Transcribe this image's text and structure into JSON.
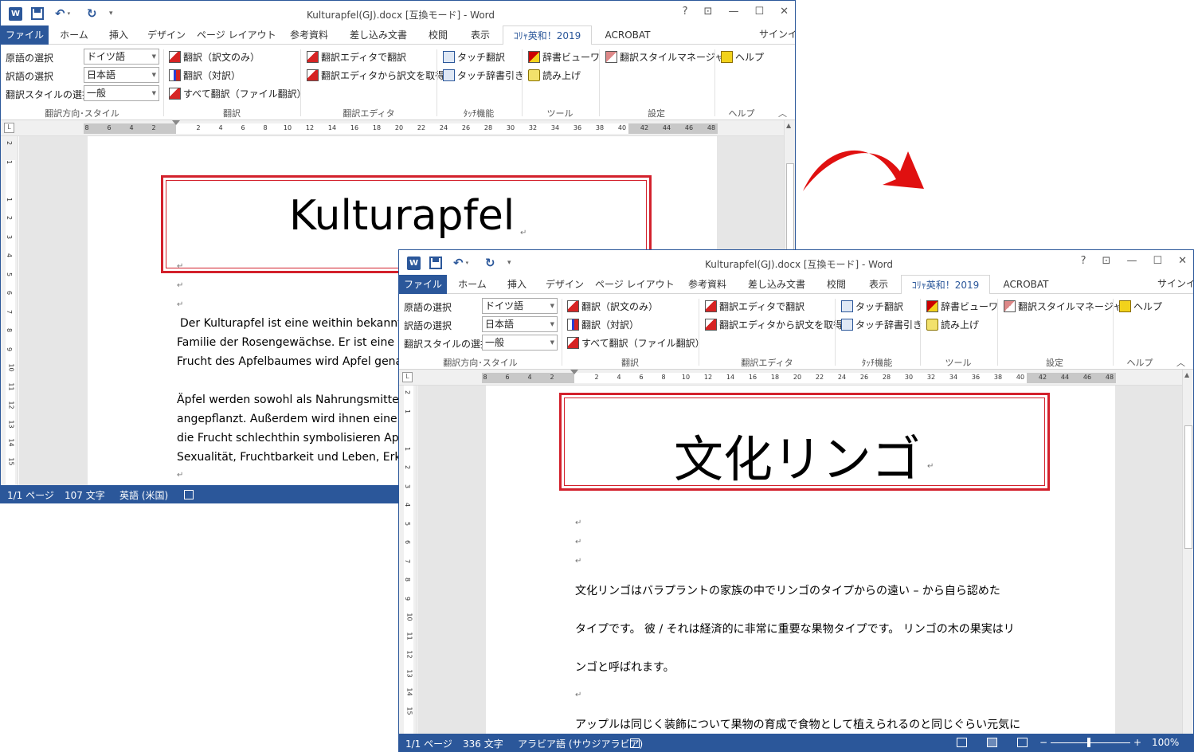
{
  "back_window": {
    "title": "Kulturapfel(GJ).docx [互換モード] - Word",
    "tabs": [
      "ファイル",
      "ホーム",
      "挿入",
      "デザイン",
      "ページ レイアウト",
      "参考資料",
      "差し込み文書",
      "校閲",
      "表示",
      "ｺﾘｬ英和！2019",
      "ACROBAT"
    ],
    "signin": "サインイン",
    "ribbon": {
      "src_lang_label": "原語の選択",
      "dst_lang_label": "訳語の選択",
      "style_label": "翻訳スタイルの選択",
      "src_lang_value": "ドイツ語",
      "dst_lang_value": "日本語",
      "style_value": "一般",
      "group_direction": "翻訳方向･スタイル",
      "btn_translate_only": "翻訳（訳文のみ）",
      "btn_translate_pair": "翻訳（対訳）",
      "btn_translate_all": "すべて翻訳（ファイル翻訳）",
      "group_translate": "翻訳",
      "btn_editor": "翻訳エディタで翻訳",
      "btn_editor_get": "翻訳エディタから訳文を取得",
      "group_editor": "翻訳エディタ",
      "btn_touch": "タッチ翻訳",
      "btn_touch_dict": "タッチ辞書引き",
      "group_touch": "ﾀｯﾁ機能",
      "btn_dict_viewer": "辞書ビューワ",
      "btn_read": "読み上げ",
      "group_tools": "ツール",
      "btn_style_mgr": "翻訳スタイルマネージャ",
      "group_settings": "設定",
      "btn_help": "ヘルプ",
      "group_help": "ヘルプ"
    },
    "doc": {
      "title": "Kulturapfel",
      "lines": [
        "Der Kulturapfel ist eine weithin bekannte",
        "Familie der Rosengewächse. Er ist eine wi",
        "Frucht des Apfelbaumes wird Apfel genan",
        "Äpfel werden sowohl als Nahrungsmittel",
        "angepflanzt. Außerdem wird ihnen eine W",
        "die Frucht schlechthin symbolisieren Apfe",
        "Sexualität, Fruchtbarkeit und Leben, Erke"
      ]
    },
    "status": {
      "page": "1/1 ページ",
      "words": "107 文字",
      "lang": "英語 (米国)"
    }
  },
  "front_window": {
    "title": "Kulturapfel(GJ).docx [互換モード] - Word",
    "doc": {
      "title": "文化リンゴ",
      "lines": [
        "文化リンゴはバラプラントの家族の中でリンゴのタイプからの遠い – から自ら認めた",
        "タイプです。 彼 / それは経済的に非常に重要な果物タイプです。 リンゴの木の果実はリ",
        "ンゴと呼ばれます。",
        "アップルは同じく装飾について果物の育成で食物として植えられるのと同じぐらい元気に"
      ]
    },
    "status": {
      "page": "1/1 ページ",
      "words": "336 文字",
      "lang": "アラビア語 (サウジアラビア)",
      "zoom": "100%"
    }
  },
  "ruler_ticks": [
    "8",
    "6",
    "4",
    "2",
    "",
    "2",
    "4",
    "6",
    "8",
    "10",
    "12",
    "14",
    "16",
    "18",
    "20",
    "22",
    "24",
    "26",
    "28",
    "30",
    "32",
    "34",
    "36",
    "38",
    "40",
    "42",
    "44",
    "46",
    "48"
  ],
  "vruler_ticks": [
    "2",
    "1",
    "",
    "1",
    "2",
    "3",
    "4",
    "5",
    "6",
    "7",
    "8",
    "9",
    "10",
    "11",
    "12",
    "13",
    "14",
    "15"
  ],
  "colors": {
    "accent": "#2b579a",
    "highlight": "#d3212c",
    "arrow": "#e01010"
  }
}
